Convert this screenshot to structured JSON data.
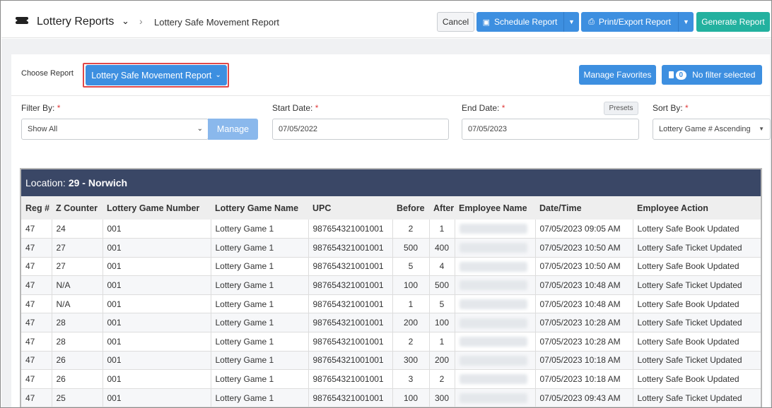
{
  "header": {
    "app_title": "Lottery Reports",
    "app_menu_icon": "chevron-down-icon",
    "breadcrumb_separator": "›",
    "breadcrumb_page": "Lottery Safe Movement Report",
    "cancel_label": "Cancel",
    "schedule_label": "Schedule Report",
    "print_label": "Print/Export Report",
    "generate_label": "Generate Report"
  },
  "controls": {
    "choose_report_label": "Choose Report",
    "report_selected": "Lottery Safe Movement Report",
    "manage_favorites_label": "Manage Favorites",
    "filter_count": "0",
    "filter_status": "No filter selected",
    "filter_by_label": "Filter By:",
    "filter_by_value": "Show All",
    "manage_label": "Manage",
    "start_date_label": "Start Date:",
    "start_date_value": "07/05/2022",
    "end_date_label": "End Date:",
    "end_date_value": "07/05/2023",
    "presets_label": "Presets",
    "sort_by_label": "Sort By:",
    "sort_by_value": "Lottery Game # Ascending",
    "required_mark": "*"
  },
  "table": {
    "location_label": "Location:",
    "location_value": "29 - Norwich",
    "columns": [
      "Reg #",
      "Z Counter",
      "Lottery Game Number",
      "Lottery Game Name",
      "UPC",
      "Before",
      "After",
      "Employee Name",
      "Date/Time",
      "Employee Action"
    ],
    "rows": [
      [
        "47",
        "24",
        "001",
        "Lottery Game 1",
        "987654321001001",
        "2",
        "1",
        "",
        "07/05/2023 09:05 AM",
        "Lottery Safe Book Updated"
      ],
      [
        "47",
        "27",
        "001",
        "Lottery Game 1",
        "987654321001001",
        "500",
        "400",
        "",
        "07/05/2023 10:50 AM",
        "Lottery Safe Ticket Updated"
      ],
      [
        "47",
        "27",
        "001",
        "Lottery Game 1",
        "987654321001001",
        "5",
        "4",
        "",
        "07/05/2023 10:50 AM",
        "Lottery Safe Book Updated"
      ],
      [
        "47",
        "N/A",
        "001",
        "Lottery Game 1",
        "987654321001001",
        "100",
        "500",
        "",
        "07/05/2023 10:48 AM",
        "Lottery Safe Ticket Updated"
      ],
      [
        "47",
        "N/A",
        "001",
        "Lottery Game 1",
        "987654321001001",
        "1",
        "5",
        "",
        "07/05/2023 10:48 AM",
        "Lottery Safe Book Updated"
      ],
      [
        "47",
        "28",
        "001",
        "Lottery Game 1",
        "987654321001001",
        "200",
        "100",
        "",
        "07/05/2023 10:28 AM",
        "Lottery Safe Ticket Updated"
      ],
      [
        "47",
        "28",
        "001",
        "Lottery Game 1",
        "987654321001001",
        "2",
        "1",
        "",
        "07/05/2023 10:28 AM",
        "Lottery Safe Book Updated"
      ],
      [
        "47",
        "26",
        "001",
        "Lottery Game 1",
        "987654321001001",
        "300",
        "200",
        "",
        "07/05/2023 10:18 AM",
        "Lottery Safe Ticket Updated"
      ],
      [
        "47",
        "26",
        "001",
        "Lottery Game 1",
        "987654321001001",
        "3",
        "2",
        "",
        "07/05/2023 10:18 AM",
        "Lottery Safe Book Updated"
      ],
      [
        "47",
        "25",
        "001",
        "Lottery Game 1",
        "987654321001001",
        "100",
        "300",
        "",
        "07/05/2023 09:43 AM",
        "Lottery Safe Ticket Updated"
      ]
    ]
  },
  "colors": {
    "primary": "#3d8fe0",
    "generate": "#23b19f",
    "location_bar": "#3a4766",
    "highlight_outline": "#e04848"
  }
}
